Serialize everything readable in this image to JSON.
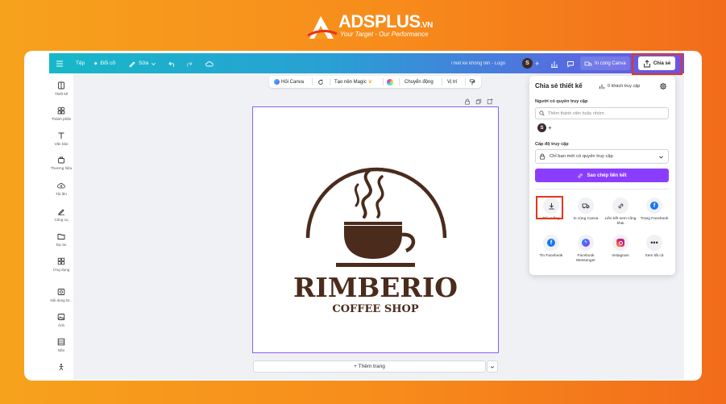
{
  "brand": {
    "name": "ADSPLUS",
    "tld": ".VN",
    "slogan": "Your Target - Our Performance"
  },
  "topbar": {
    "file_label": "Tệp",
    "resize_label": "Đổi cỡ",
    "edit_label": "Sửa",
    "doc_title": "Thiết kế không tên - Logo",
    "avatar_initial": "S",
    "print_label": "In cùng Canva",
    "share_label": "Chia sẻ"
  },
  "sidebar": {
    "items": [
      {
        "label": "Thiết kế",
        "icon": "layout-icon"
      },
      {
        "label": "Thành phần",
        "icon": "elements-icon"
      },
      {
        "label": "Văn bản",
        "icon": "text-icon"
      },
      {
        "label": "Thương hiệu",
        "icon": "brand-icon"
      },
      {
        "label": "Tải lên",
        "icon": "upload-icon"
      },
      {
        "label": "Công cụ",
        "icon": "draw-icon"
      },
      {
        "label": "Dự án",
        "icon": "folder-icon"
      },
      {
        "label": "Ứng dụng",
        "icon": "apps-icon"
      },
      {
        "label": "Nội dung M...",
        "icon": "media-icon"
      },
      {
        "label": "Ảnh",
        "icon": "photo-icon"
      },
      {
        "label": "Nền",
        "icon": "background-icon"
      },
      {
        "label": "",
        "icon": "more-icon"
      }
    ]
  },
  "context_toolbar": {
    "ask_canva": "Hỏi Canva",
    "magic": "Tạo nên Magic",
    "animate": "Chuyển động",
    "position": "Vị trí"
  },
  "canvas": {
    "logo_title": "RIMBERIO",
    "logo_subtitle": "COFFEE SHOP",
    "add_page_label": "+ Thêm trang"
  },
  "share_panel": {
    "title": "Chia sẻ thiết kế",
    "viewers": "0 khách truy cập",
    "people_label": "Người có quyền truy cập",
    "search_placeholder": "Thêm thành viên hoặc nhóm",
    "member_initial": "S",
    "access_label": "Cấp độ truy cập",
    "access_value": "Chỉ bạn mới có quyền truy cập",
    "copy_link": "Sao chép liên kết",
    "options": [
      {
        "label": "Tải xuống",
        "icon": "download-icon"
      },
      {
        "label": "In cùng Canva",
        "icon": "truck-icon"
      },
      {
        "label": "Liên kết xem công khai",
        "icon": "link-icon"
      },
      {
        "label": "Trang Facebook",
        "icon": "facebook-icon"
      },
      {
        "label": "Tin Facebook",
        "icon": "facebook-story-icon"
      },
      {
        "label": "Facebook Messenger",
        "icon": "messenger-icon"
      },
      {
        "label": "Instagram",
        "icon": "instagram-icon"
      },
      {
        "label": "Xem tất cả",
        "icon": "more-icon"
      }
    ]
  },
  "colors": {
    "accent_purple": "#8b3dff",
    "highlight_red": "#e8341c",
    "coffee_brown": "#4a2b1c",
    "facebook_blue": "#1877f2"
  }
}
